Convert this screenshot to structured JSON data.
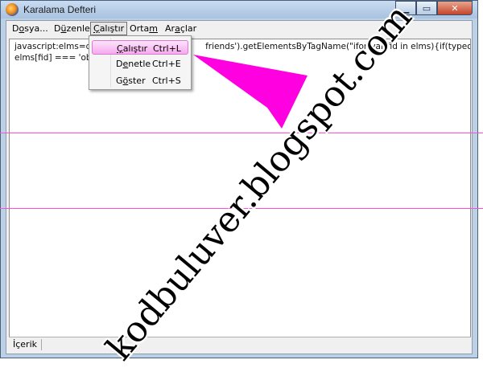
{
  "window": {
    "title": "Karalama Defteri"
  },
  "menubar": {
    "items": [
      {
        "pre": "D",
        "ul": "o",
        "post": "sya..."
      },
      {
        "pre": "D",
        "ul": "ü",
        "post": "zenle"
      },
      {
        "pre": "",
        "ul": "Ç",
        "post": "alıştır"
      },
      {
        "pre": "Orta",
        "ul": "m",
        "post": ""
      },
      {
        "pre": "Ar",
        "ul": "a",
        "post": "çlar"
      }
    ]
  },
  "dropdown": {
    "items": [
      {
        "pre": "",
        "ul": "Ç",
        "post": "alıştır",
        "shortcut": "Ctrl+L"
      },
      {
        "pre": "D",
        "ul": "e",
        "post": "netle",
        "shortcut": "Ctrl+E"
      },
      {
        "pre": "G",
        "ul": "ö",
        "post": "ster",
        "shortcut": "Ctrl+S"
      }
    ]
  },
  "editor": {
    "line1_a": "javascript:elms=dc",
    "line1_b": "friends').getElementsByTagName(\"i",
    "line1_c": "for(var fid in elms){if(typeof",
    "line2": "elms[fid] === 'obj"
  },
  "statusbar": {
    "text": "İçerik"
  },
  "watermark": {
    "text": "kodbuluver.blogspot.com"
  },
  "colors": {
    "accent": "#ff00e0",
    "guide": "#ff4fd8"
  }
}
